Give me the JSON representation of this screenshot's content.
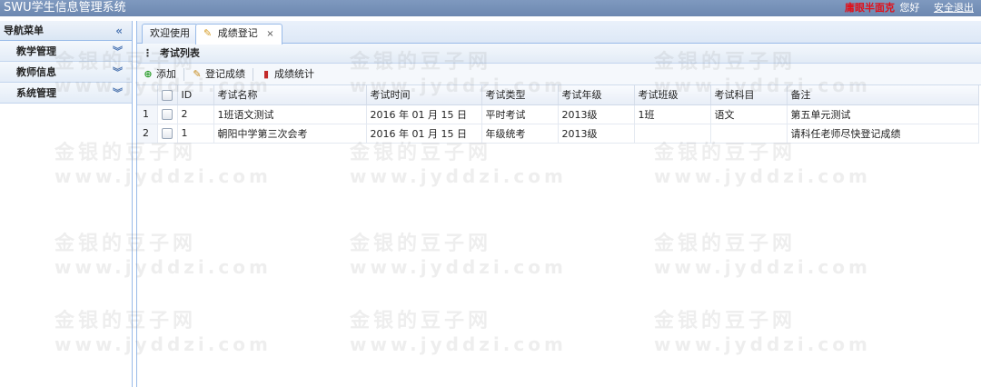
{
  "header": {
    "title": "SWU学生信息管理系统",
    "user": "庸眼半面克",
    "greeting": "您好",
    "logout": "安全退出"
  },
  "sidebar": {
    "title": "导航菜单",
    "items": [
      {
        "label": "教学管理"
      },
      {
        "label": "教师信息"
      },
      {
        "label": "系统管理"
      }
    ]
  },
  "tabs": [
    {
      "label": "欢迎使用"
    },
    {
      "label": "成绩登记"
    }
  ],
  "panel": {
    "title": "考试列表"
  },
  "toolbar": {
    "add": "添加",
    "register": "登记成绩",
    "stats": "成绩统计"
  },
  "table": {
    "columns": [
      "ID",
      "考试名称",
      "考试时间",
      "考试类型",
      "考试年级",
      "考试班级",
      "考试科目",
      "备注"
    ],
    "rows": [
      {
        "rn": "1",
        "id": "2",
        "name": "1班语文测试",
        "time": "2016 年 01 月 15 日",
        "type": "平时考试",
        "grade": "2013级",
        "class": "1班",
        "subject": "语文",
        "note": "第五单元测试"
      },
      {
        "rn": "2",
        "id": "1",
        "name": "朝阳中学第三次会考",
        "time": "2016 年 01 月 15 日",
        "type": "年级统考",
        "grade": "2013级",
        "class": "",
        "subject": "",
        "note": "请科任老师尽快登记成绩"
      }
    ]
  },
  "watermark": {
    "cn": "金银的豆子网",
    "en": "www.jyddzi.com"
  }
}
